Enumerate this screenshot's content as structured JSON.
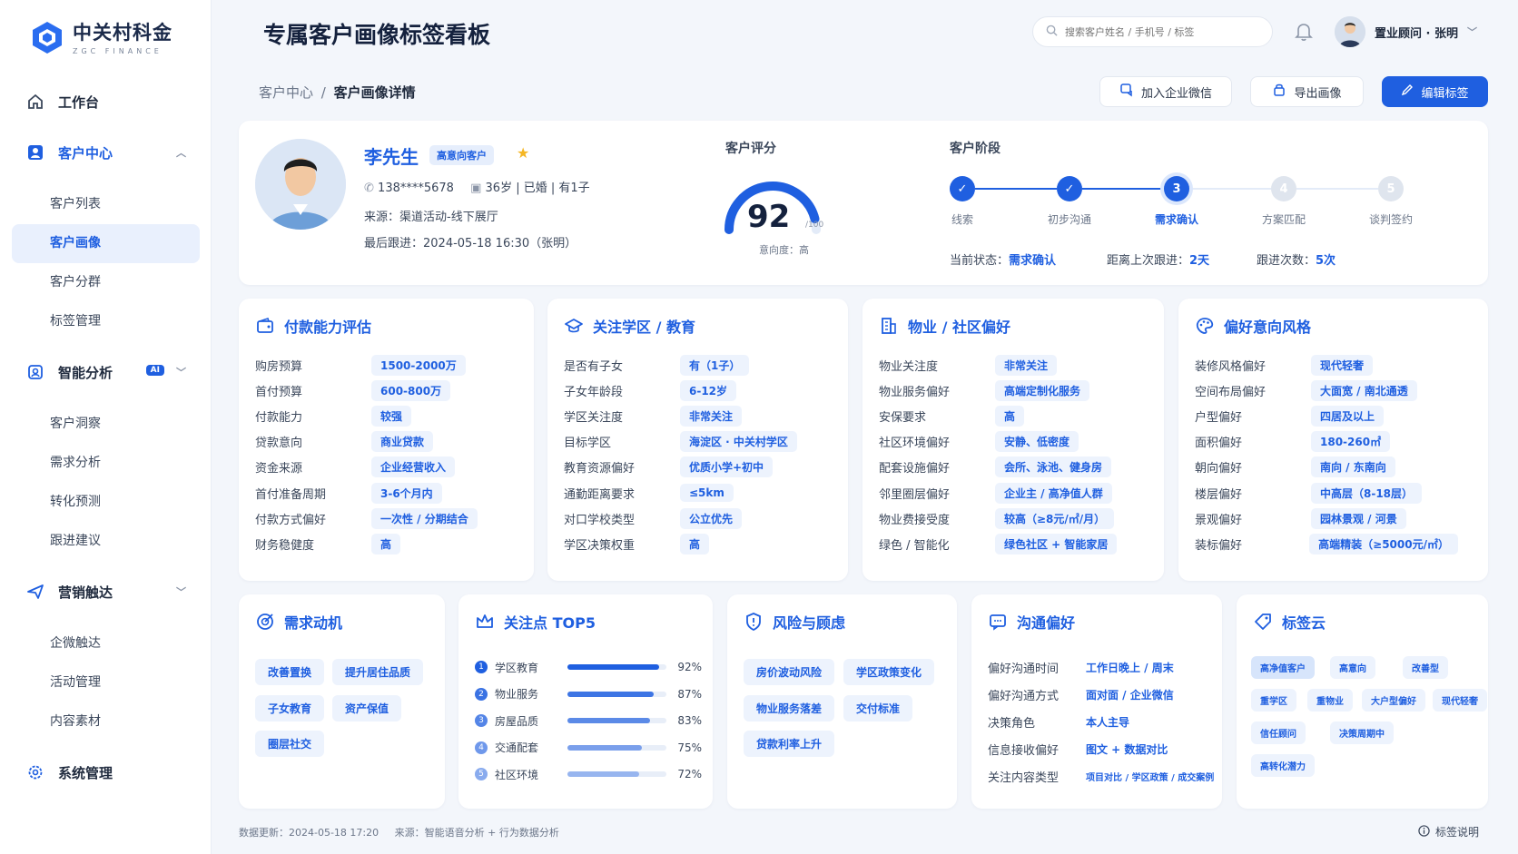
{
  "brand": {
    "name_cn": "中关村科金",
    "name_en": "ZGC FINANCE"
  },
  "nav": {
    "workbench": "工作台",
    "customer_center": "客户中心",
    "customer_subs": [
      "客户列表",
      "客户画像",
      "客户分群",
      "标签管理"
    ],
    "smart_analysis": "智能分析",
    "ai_badge": "AI",
    "analysis_subs": [
      "客户洞察",
      "需求分析",
      "转化预测",
      "跟进建议"
    ],
    "marketing": "营销触达",
    "marketing_subs": [
      "企微触达",
      "活动管理",
      "内容素材"
    ],
    "system": "系统管理"
  },
  "header": {
    "title": "专属客户画像标签看板",
    "search_placeholder": "搜索客户姓名 / 手机号 / 标签",
    "user": "置业顾问 · 张明"
  },
  "breadcrumb": {
    "parent": "客户中心",
    "sep": "/",
    "current": "客户画像详情"
  },
  "actions": {
    "wecom": "加入企业微信",
    "export": "导出画像",
    "edit": "编辑标签"
  },
  "profile": {
    "name": "李先生",
    "badge": "高意向客户",
    "phone": "138****5678",
    "basic": "36岁 | 已婚 | 有1子",
    "source": "来源：渠道活动-线下展厅",
    "last_follow": "最后跟进：2024-05-18 16:30（张明）",
    "score_title": "客户评分",
    "score": 92,
    "score_max": "/100",
    "intent": "意向度：高",
    "stage_title": "客户阶段",
    "stages": [
      "线索",
      "初步沟通",
      "需求确认",
      "方案匹配",
      "谈判签约"
    ],
    "stage_current": 3,
    "status_label": "当前状态：",
    "status_value": "需求确认",
    "since_label": "距离上次跟进：",
    "since_value": "2天",
    "count_label": "跟进次数：",
    "count_value": "5次"
  },
  "cards": {
    "payment": {
      "title": "付款能力评估",
      "rows": [
        {
          "k": "购房预算",
          "v": "1500-2000万"
        },
        {
          "k": "首付预算",
          "v": "600-800万"
        },
        {
          "k": "付款能力",
          "v": "较强"
        },
        {
          "k": "贷款意向",
          "v": "商业贷款"
        },
        {
          "k": "资金来源",
          "v": "企业经营收入"
        },
        {
          "k": "首付准备周期",
          "v": "3-6个月内"
        },
        {
          "k": "付款方式偏好",
          "v": "一次性 / 分期结合"
        },
        {
          "k": "财务稳健度",
          "v": "高"
        }
      ]
    },
    "school": {
      "title": "关注学区 / 教育",
      "rows": [
        {
          "k": "是否有子女",
          "v": "有（1子）"
        },
        {
          "k": "子女年龄段",
          "v": "6-12岁"
        },
        {
          "k": "学区关注度",
          "v": "非常关注"
        },
        {
          "k": "目标学区",
          "v": "海淀区 · 中关村学区"
        },
        {
          "k": "教育资源偏好",
          "v": "优质小学+初中"
        },
        {
          "k": "通勤距离要求",
          "v": "≤5km"
        },
        {
          "k": "对口学校类型",
          "v": "公立优先"
        },
        {
          "k": "学区决策权重",
          "v": "高"
        }
      ]
    },
    "property": {
      "title": "物业 / 社区偏好",
      "rows": [
        {
          "k": "物业关注度",
          "v": "非常关注"
        },
        {
          "k": "物业服务偏好",
          "v": "高端定制化服务"
        },
        {
          "k": "安保要求",
          "v": "高"
        },
        {
          "k": "社区环境偏好",
          "v": "安静、低密度"
        },
        {
          "k": "配套设施偏好",
          "v": "会所、泳池、健身房"
        },
        {
          "k": "邻里圈层偏好",
          "v": "企业主 / 高净值人群"
        },
        {
          "k": "物业费接受度",
          "v": "较高（≥8元/㎡/月）"
        },
        {
          "k": "绿色 / 智能化",
          "v": "绿色社区 + 智能家居"
        }
      ]
    },
    "style": {
      "title": "偏好意向风格",
      "rows": [
        {
          "k": "装修风格偏好",
          "v": "现代轻奢"
        },
        {
          "k": "空间布局偏好",
          "v": "大面宽 / 南北通透"
        },
        {
          "k": "户型偏好",
          "v": "四居及以上"
        },
        {
          "k": "面积偏好",
          "v": "180-260㎡"
        },
        {
          "k": "朝向偏好",
          "v": "南向 / 东南向"
        },
        {
          "k": "楼层偏好",
          "v": "中高层（8-18层）"
        },
        {
          "k": "景观偏好",
          "v": "园林景观 / 河景"
        },
        {
          "k": "装标偏好",
          "v": "高端精装（≥5000元/㎡）"
        }
      ]
    },
    "motive": {
      "title": "需求动机",
      "chips": [
        "改善置换",
        "提升居住品质",
        "子女教育",
        "资产保值",
        "圈层社交"
      ]
    },
    "top5": {
      "title": "关注点 TOP5",
      "items": [
        {
          "n": "1",
          "label": "学区教育",
          "pct": 92,
          "pct_text": "92%"
        },
        {
          "n": "2",
          "label": "物业服务",
          "pct": 87,
          "pct_text": "87%"
        },
        {
          "n": "3",
          "label": "房屋品质",
          "pct": 83,
          "pct_text": "83%"
        },
        {
          "n": "4",
          "label": "交通配套",
          "pct": 75,
          "pct_text": "75%"
        },
        {
          "n": "5",
          "label": "社区环境",
          "pct": 72,
          "pct_text": "72%"
        }
      ]
    },
    "risk": {
      "title": "风险与顾虑",
      "chips": [
        "房价波动风险",
        "学区政策变化",
        "物业服务落差",
        "交付标准",
        "贷款利率上升"
      ]
    },
    "comm": {
      "title": "沟通偏好",
      "rows": [
        {
          "k": "偏好沟通时间",
          "v": "工作日晚上 / 周末"
        },
        {
          "k": "偏好沟通方式",
          "v": "面对面 / 企业微信"
        },
        {
          "k": "决策角色",
          "v": "本人主导"
        },
        {
          "k": "信息接收偏好",
          "v": "图文 + 数据对比"
        },
        {
          "k": "关注内容类型",
          "v": "项目对比 / 学区政策 / 成交案例"
        }
      ]
    },
    "tags": {
      "title": "标签云",
      "chips": [
        "高净值客户",
        "高意向",
        "改善型",
        "重学区",
        "重物业",
        "大户型偏好",
        "现代轻奢",
        "信任顾问",
        "决策周期中",
        "高转化潜力"
      ]
    }
  },
  "footer": {
    "update": "数据更新：2024-05-18 17:20",
    "source": "来源：智能语音分析 + 行为数据分析",
    "help": "标签说明"
  },
  "colors": {
    "accent": "#1f5fe0",
    "chip_bg": "#edf3fd",
    "bg": "#f3f6fb"
  }
}
